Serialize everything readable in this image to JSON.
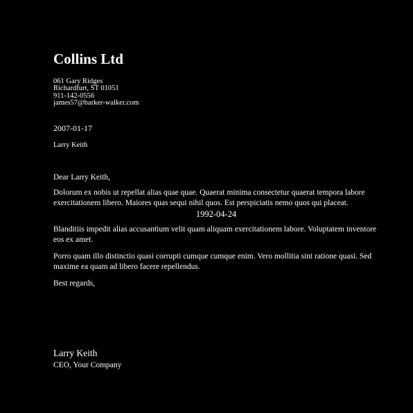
{
  "letterhead": {
    "company": "Collins Ltd",
    "address_line1": "061 Gary Ridges",
    "address_line2": "Richardfurt, ST 01051",
    "phone": "911-142-0556",
    "email": "james57@barker-walker.com"
  },
  "letter": {
    "date": "2007-01-17",
    "recipient": "Larry Keith",
    "salutation": "Dear Larry Keith,",
    "paragraph1": "Dolorum ex nobis ut repellat alias quae quae. Quaerat minima consectetur quaerat tempora labore exercitationem libero. Maiores quas sequi nihil quos. Est perspiciatis nemo quos qui placeat.",
    "inline_date": "1992-04-24",
    "paragraph2": "Blanditiis impedit alias accusantium velit quam aliquam exercitationem labore. Voluptatem inventore eos ex amet.",
    "paragraph3": "Porro quam illo distinctio quasi corrupti cumque cumque enim. Vero mollitia sint ratione quasi. Sed maxime ea quam ad libero facere repellendus.",
    "closing": "Best regards,"
  },
  "signature": {
    "name": "Larry Keith",
    "title": "CEO, Your Company"
  },
  "colors": {
    "background": "#000000",
    "text": "#ffffff"
  }
}
